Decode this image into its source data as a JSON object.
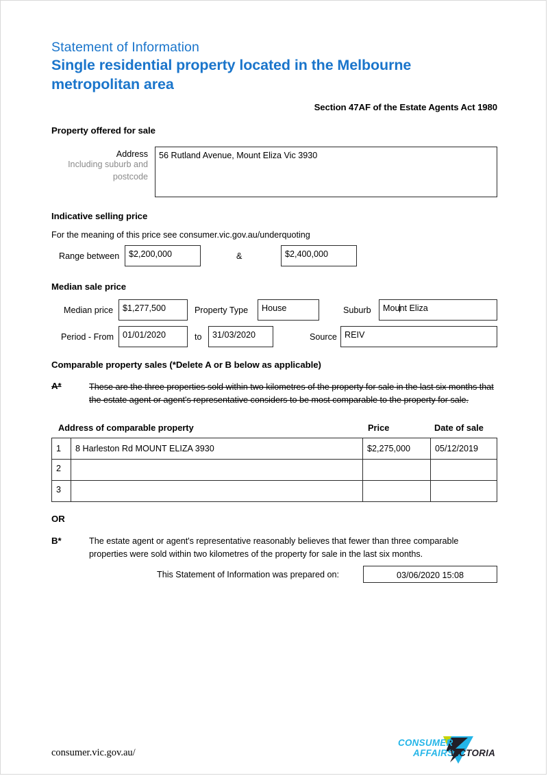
{
  "header": {
    "eyebrow": "Statement of Information",
    "title": "Single residential property located in the Melbourne metropolitan area",
    "act_line": "Section 47AF of the Estate Agents Act 1980"
  },
  "property": {
    "heading": "Property offered for sale",
    "address_label": "Address",
    "address_sublabel_1": "Including suburb and",
    "address_sublabel_2": "postcode",
    "address_value": "56 Rutland Avenue, Mount Eliza Vic 3930"
  },
  "indicative": {
    "heading": "Indicative selling price",
    "meaning_note": "For the meaning of this price see consumer.vic.gov.au/underquoting",
    "range_label": "Range between",
    "range_low": "$2,200,000",
    "ampersand": "&",
    "range_high": "$2,400,000"
  },
  "median": {
    "heading": "Median sale price",
    "median_price_label": "Median price",
    "median_price_value": "$1,277,500",
    "property_type_label": "Property Type",
    "property_type_value": "House",
    "suburb_label": "Suburb",
    "suburb_value_before_caret": "Mou",
    "suburb_value_after_caret": "nt Eliza",
    "period_from_label": "Period - From",
    "period_from_value": "01/01/2020",
    "period_to_label": "to",
    "period_to_value": "31/03/2020",
    "source_label": "Source",
    "source_value": "REIV"
  },
  "comparable": {
    "heading": "Comparable property sales (*Delete A or B below as applicable)",
    "option_a_marker": "A*",
    "option_a_text": "These are the three properties sold within two kilometres of the property for sale in the last six months that the estate agent or agent's representative considers to be most comparable to the property for sale.",
    "table_headers": {
      "address": "Address of comparable property",
      "price": "Price",
      "date": "Date of sale"
    },
    "rows": [
      {
        "num": "1",
        "address": "8 Harleston Rd MOUNT ELIZA 3930",
        "price": "$2,275,000",
        "date": "05/12/2019"
      },
      {
        "num": "2",
        "address": "",
        "price": "",
        "date": ""
      },
      {
        "num": "3",
        "address": "",
        "price": "",
        "date": ""
      }
    ],
    "or_label": "OR",
    "option_b_marker": "B*",
    "option_b_text": "The estate agent or agent's representative reasonably believes that fewer than three comparable properties were sold within two kilometres of the property for sale in the last six months."
  },
  "prepared": {
    "label": "This Statement of Information was prepared on:",
    "value": "03/06/2020 15:08"
  },
  "footer": {
    "url": "consumer.vic.gov.au/",
    "logo": {
      "line1": "CONSUMER",
      "line2": "AFFAIRS",
      "line3": "VICTORIA"
    }
  },
  "colors": {
    "heading_blue": "#1a75cb",
    "logo_cyan": "#23b5e8",
    "logo_dark": "#221f28",
    "box_border": "#2b2b2b",
    "gray_label": "#8a8a8a"
  }
}
